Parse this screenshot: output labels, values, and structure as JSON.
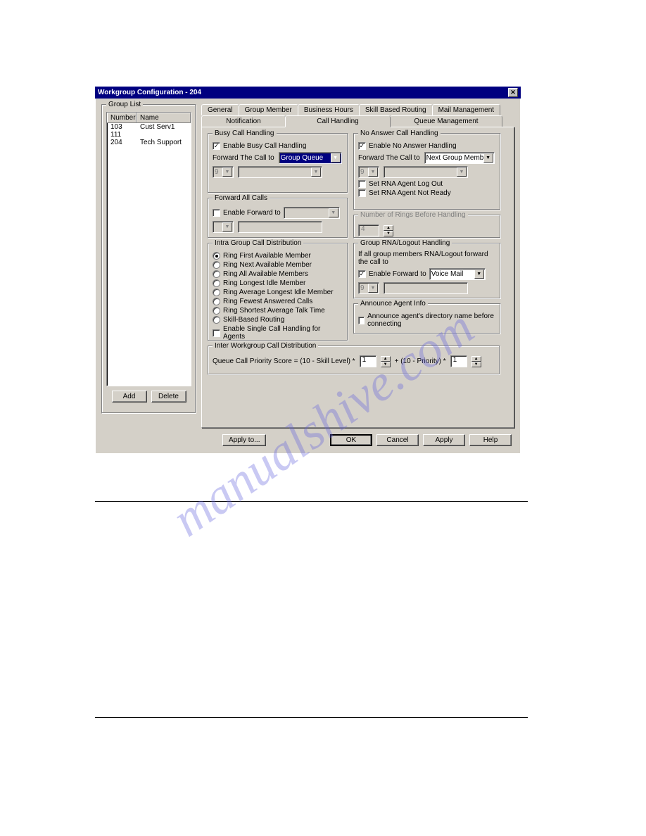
{
  "window": {
    "title": "Workgroup Configuration - 204"
  },
  "groupList": {
    "legend": "Group List",
    "headers": {
      "number": "Number",
      "name": "Name"
    },
    "rows": [
      {
        "number": "103",
        "name": "Cust Serv1"
      },
      {
        "number": "111",
        "name": ""
      },
      {
        "number": "204",
        "name": "Tech Support"
      }
    ],
    "addBtn": "Add",
    "deleteBtn": "Delete"
  },
  "tabs": {
    "row1": [
      "General",
      "Group Member",
      "Business Hours",
      "Skill Based Routing",
      "Mail Management"
    ],
    "row2": [
      "Notification",
      "Call Handling",
      "Queue Management"
    ]
  },
  "busyCall": {
    "legend": "Busy Call Handling",
    "enable": "Enable Busy Call Handling",
    "forwardLabel": "Forward The Call to",
    "forwardValue": "Group Queue",
    "numValue": "9"
  },
  "forwardAll": {
    "legend": "Forward All Calls",
    "enable": "Enable Forward to"
  },
  "intraGroup": {
    "legend": "Intra Group Call Distribution",
    "options": [
      "Ring First Available Member",
      "Ring Next Available Member",
      "Ring All Available Members",
      "Ring Longest Idle Member",
      "Ring Average Longest Idle Member",
      "Ring Fewest Answered Calls",
      "Ring Shortest Average Talk Time",
      "Skill-Based Routing"
    ],
    "singleCall": "Enable Single Call Handling for Agents"
  },
  "interWg": {
    "legend": "Inter Workgroup Call Distribution",
    "formula1": "Queue Call Priority Score = (10 - Skill Level) *",
    "val1": "1",
    "formula2": "+ (10 - Priority) *",
    "val2": "1"
  },
  "noAnswer": {
    "legend": "No Answer Call Handling",
    "enable": "Enable No Answer Handling",
    "forwardLabel": "Forward The Call to",
    "forwardValue": "Next Group Member",
    "numValue": "9",
    "logout": "Set RNA Agent Log Out",
    "notReady": "Set RNA Agent Not Ready"
  },
  "ringsBefore": {
    "legend": "Number of Rings Before Handling",
    "value": "4"
  },
  "groupRna": {
    "legend": "Group RNA/Logout Handling",
    "desc": "If all group members RNA/Logout forward the call to",
    "enable": "Enable Forward to",
    "forwardValue": "Voice Mail",
    "numValue": "9"
  },
  "announce": {
    "legend": "Announce Agent Info",
    "text": "Announce agent's directory name before connecting"
  },
  "buttons": {
    "applyTo": "Apply to...",
    "ok": "OK",
    "cancel": "Cancel",
    "apply": "Apply",
    "help": "Help"
  },
  "watermark": "manualshive.com"
}
